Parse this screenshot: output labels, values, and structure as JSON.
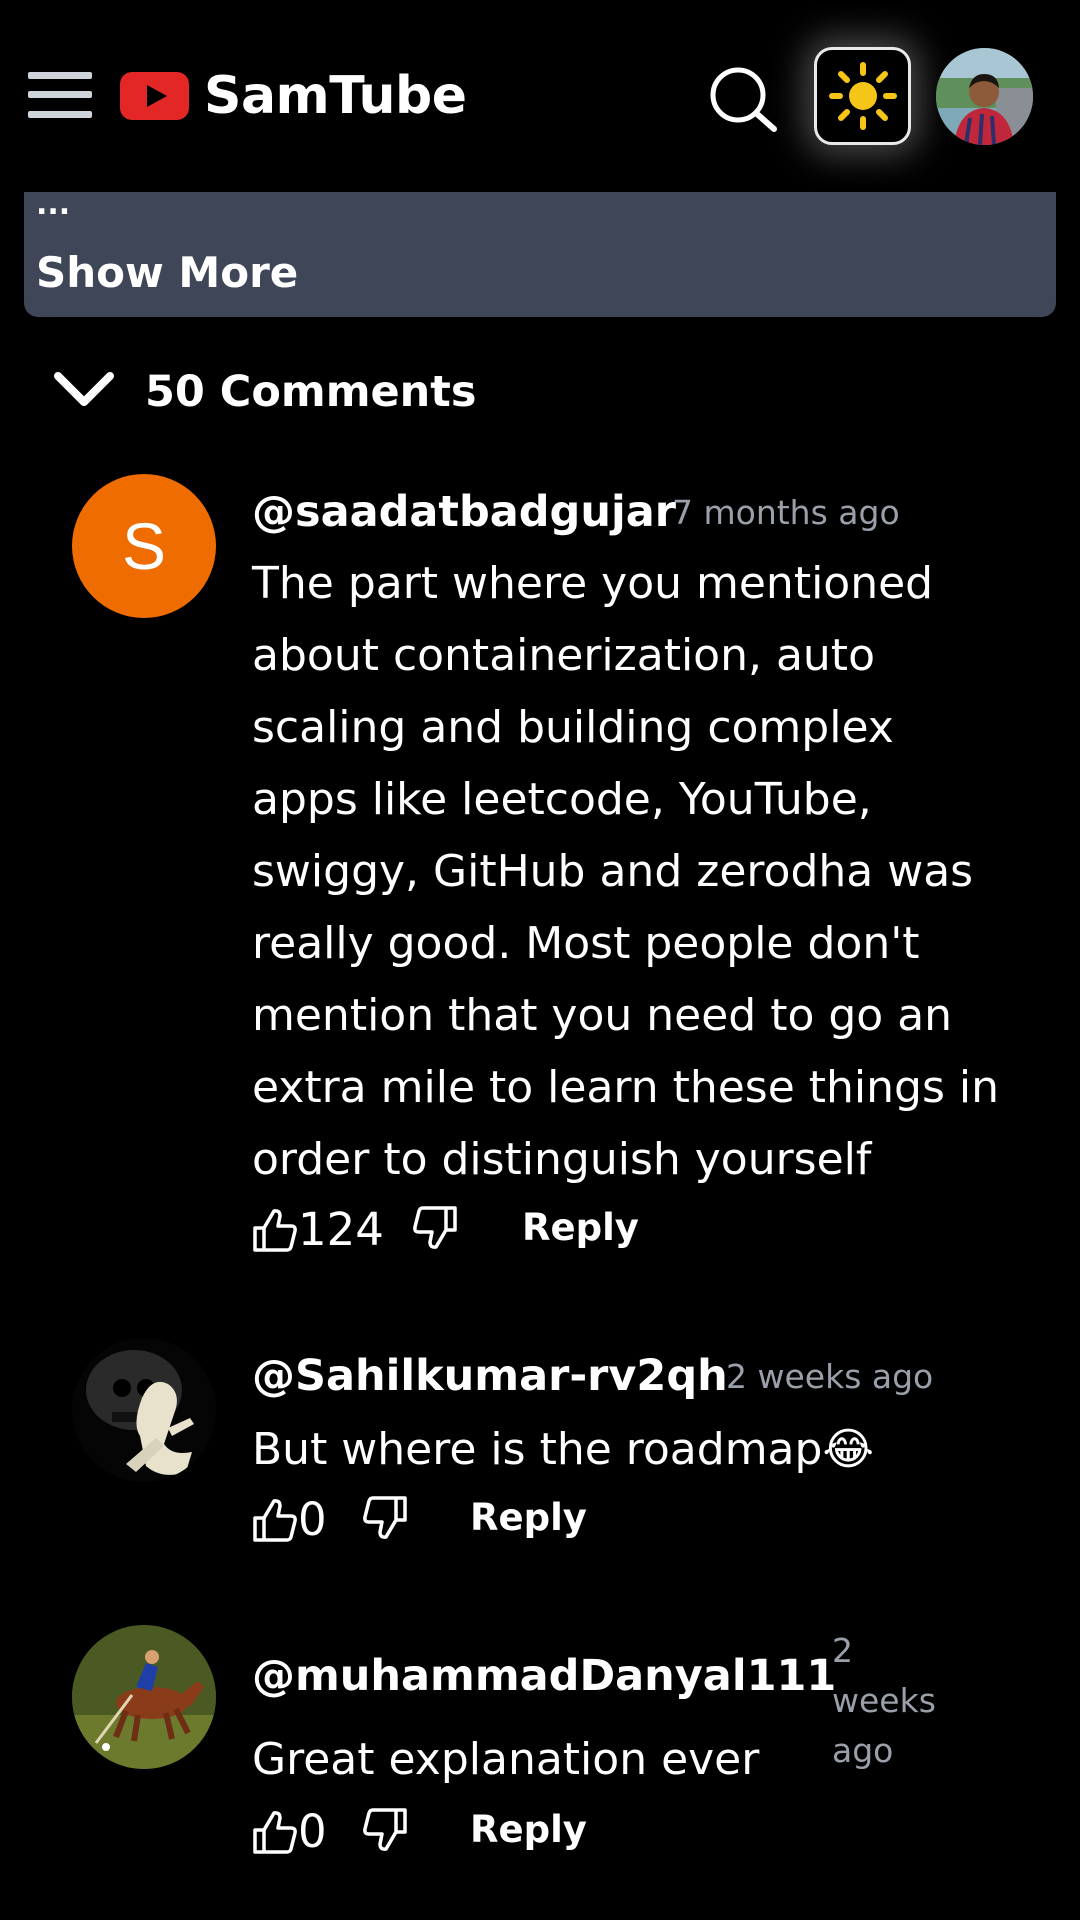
{
  "header": {
    "brand": "SamTube",
    "logo_color": "#e32626",
    "menu_icon": "hamburger-menu-icon",
    "search_icon": "search-icon",
    "theme_icon": "sun-icon",
    "sun_color": "#f5c518"
  },
  "description": {
    "ellipsis": "...",
    "show_more_label": "Show More",
    "card_color": "#3e4657"
  },
  "comments_section": {
    "count_label": "50 Comments",
    "toggle_icon": "chevron-down-icon"
  },
  "comments": [
    {
      "author": "@saadatbadgujar",
      "time": "7 months ago",
      "avatar_letter": "S",
      "avatar_color": "#ef6c00",
      "text": "The part where you mentioned about containerization, auto scaling and building complex apps like leetcode, YouTube, swiggy, GitHub and zerodha was really good. Most people don't mention that you need to go an extra mile to learn these things in order to distinguish yourself",
      "likes": "124",
      "reply_label": "Reply"
    },
    {
      "author": "@Sahilkumar-rv2qh",
      "time": "2 weeks ago",
      "text": "But where is the roadmap😂",
      "likes": "0",
      "reply_label": "Reply"
    },
    {
      "author": "@muhammadDanyal111",
      "time": "2 weeks ago",
      "text": "Great explanation ever",
      "likes": "0",
      "reply_label": "Reply"
    }
  ]
}
